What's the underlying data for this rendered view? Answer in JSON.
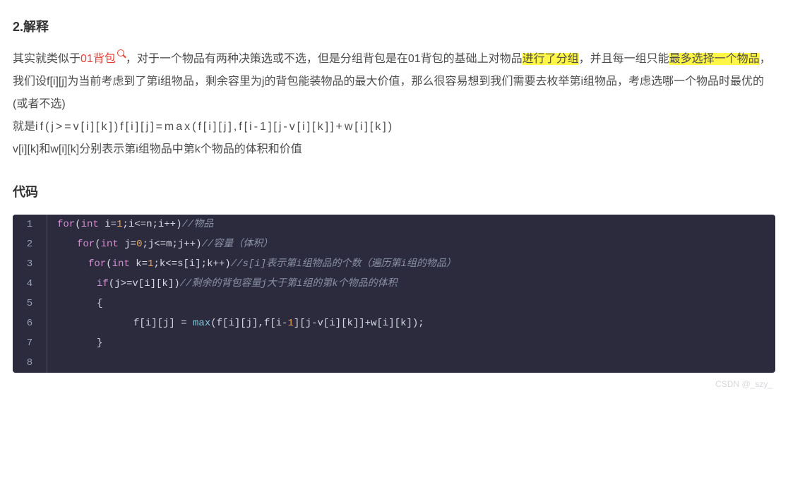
{
  "heading": "2.解释",
  "para": {
    "t1": "其实就类似于",
    "link": "01背包",
    "t2": "，对于一个物品有两种决策选或不选，但是分组背包是在01背包的基础上对物品",
    "hl1": "进行了分组",
    "t3": "，并且每一组只能",
    "hl2": "最多选择一个物品",
    "t4": "，",
    "t5": "我们设f[i][j]为当前考虑到了第i组物品，剩余容里为j的背包能装物品的最大价值，那么很容易想到我们需要去枚举第i组物品，考虑选哪一个物品时最优的(或者不选)",
    "t6a": "就是",
    "t6b": "if(j>=v[i][k])f[i][j]=max(f[i][j],f[i-1][j-v[i][k]]+w[i][k])",
    "t7": "v[i][k]和w[i][k]分别表示第i组物品中第k个物品的体积和价值"
  },
  "code_heading": "代码",
  "code": {
    "l1": {
      "kw": "for",
      "open": "(",
      "ty": "int",
      "rest": " i=",
      "n1": "1",
      "sc": ";i<=n;i++)",
      "cmt": "//物品"
    },
    "l2": {
      "kw": "for",
      "open": "(",
      "ty": "int",
      "rest": " j=",
      "n1": "0",
      "sc": ";j<=m;j++)",
      "cmt": "//容量（体积）"
    },
    "l3": {
      "kw": "for",
      "open": "(",
      "ty": "int",
      "rest": " k=",
      "n1": "1",
      "sc": ";k<=s[i];k++)",
      "cmt": "//s[i]表示第i组物品的个数（遍历第i组的物品）"
    },
    "l4": {
      "kw": "if",
      "cond": "(j>=v[i][k])",
      "cmt": "//剩余的背包容量j大于第i组的第k个物品的体积"
    },
    "l5": {
      "brace": "{"
    },
    "l6": {
      "lhs": "f[i][j] = ",
      "fn": "max",
      "args": "(f[i][j],f[i-",
      "n1": "1",
      "args2": "][j-v[i][k]]+w[i][k]);"
    },
    "l7": {
      "brace": "}"
    },
    "l8": {
      "blank": ""
    }
  },
  "watermark": "CSDN @_szy_"
}
